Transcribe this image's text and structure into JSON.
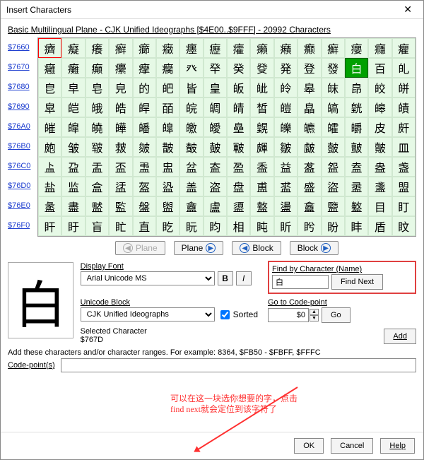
{
  "window": {
    "title": "Insert Characters"
  },
  "plane": {
    "header": "Basic Multilingual Plane - CJK Unified Ideographs [$4E00..$9FFF] - 20992 Characters"
  },
  "rows": [
    "$7660",
    "$7670",
    "$7680",
    "$7690",
    "$76A0",
    "$76B0",
    "$76C0",
    "$76D0",
    "$76E0",
    "$76F0"
  ],
  "selectedIndex": 29,
  "highlightFirst": true,
  "chars": [
    "癠",
    "癡",
    "癢",
    "癣",
    "癤",
    "癥",
    "癦",
    "癧",
    "癨",
    "癩",
    "癪",
    "癫",
    "癬",
    "癭",
    "癮",
    "癯",
    "癰",
    "癱",
    "癲",
    "癳",
    "癴",
    "癵",
    "癶",
    "癷",
    "癸",
    "癹",
    "発",
    "登",
    "發",
    "白",
    "百",
    "癿",
    "皀",
    "皁",
    "皂",
    "皃",
    "的",
    "皅",
    "皆",
    "皇",
    "皈",
    "皉",
    "皊",
    "皋",
    "皌",
    "皍",
    "皎",
    "皏",
    "皐",
    "皑",
    "皒",
    "皓",
    "皔",
    "皕",
    "皖",
    "皗",
    "皘",
    "皙",
    "皚",
    "皛",
    "皜",
    "皝",
    "皞",
    "皟",
    "皠",
    "皡",
    "皢",
    "皣",
    "皤",
    "皥",
    "皦",
    "皧",
    "皨",
    "皩",
    "皪",
    "皫",
    "皬",
    "皭",
    "皮",
    "皯",
    "皰",
    "皱",
    "皲",
    "皳",
    "皴",
    "皵",
    "皶",
    "皷",
    "皸",
    "皹",
    "皺",
    "皻",
    "皼",
    "皽",
    "皾",
    "皿",
    "盀",
    "盁",
    "盂",
    "盃",
    "盄",
    "盅",
    "盆",
    "盇",
    "盈",
    "盉",
    "益",
    "盋",
    "盌",
    "盍",
    "盎",
    "盏",
    "盐",
    "监",
    "盒",
    "盓",
    "盔",
    "盕",
    "盖",
    "盗",
    "盘",
    "盙",
    "盚",
    "盛",
    "盜",
    "盝",
    "盞",
    "盟",
    "盠",
    "盡",
    "盢",
    "監",
    "盤",
    "盥",
    "盦",
    "盧",
    "盨",
    "盩",
    "盪",
    "盫",
    "盬",
    "盭",
    "目",
    "盯",
    "盰",
    "盱",
    "盲",
    "盳",
    "直",
    "盵",
    "盶",
    "盷",
    "相",
    "盹",
    "盺",
    "盻",
    "盼",
    "盽",
    "盾",
    "盿"
  ],
  "nav": {
    "planePrev": "Plane",
    "planeNext": "Plane",
    "blockPrev": "Block",
    "blockNext": "Block"
  },
  "labels": {
    "displayFont": "Display Font",
    "findByChar": "Find by Character (Name)",
    "findNext": "Find Next",
    "unicodeBlock": "Unicode Block",
    "sorted": "Sorted",
    "gotoCodepoint": "Go to Code-point",
    "go": "Go",
    "selectedChar": "Selected Character",
    "add": "Add",
    "addRanges": "Add these characters and/or character ranges. For example: 8364, $FB50 - $FBFF, $FFFC",
    "codepoints": "Code-point(s)"
  },
  "values": {
    "displayFont": "Arial Unicode MS",
    "unicodeBlock": "CJK Unified Ideographs",
    "findValue": "白",
    "codepoint": "$0"
  },
  "selected": {
    "glyph": "白",
    "code": "$767D"
  },
  "annotation": {
    "line1": "可以在这一块选你想要的字，点击",
    "line2": "find next就会定位到该字符了"
  },
  "buttons": {
    "ok": "OK",
    "cancel": "Cancel",
    "help": "Help"
  }
}
